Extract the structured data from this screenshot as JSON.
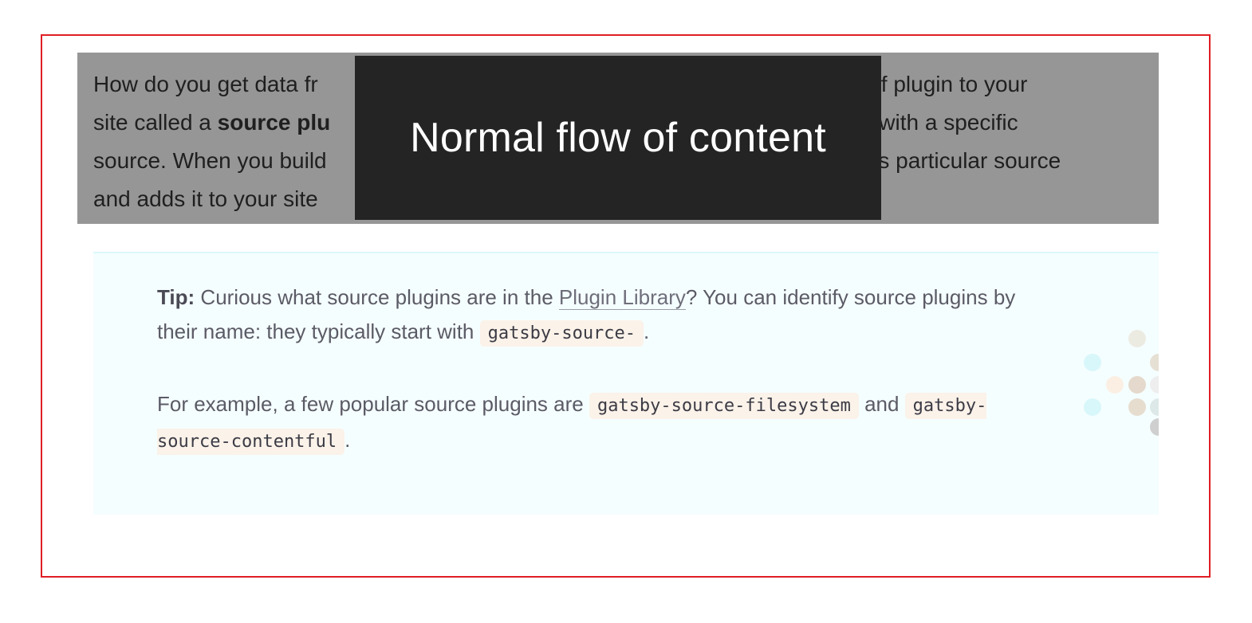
{
  "intro": {
    "text_start": "How do you get data fr",
    "text_mid_1": " type of plugin to your",
    "line2_start": "site called a ",
    "bold_term": "source plu",
    "line2_end": "unicate with a specific",
    "line3_start": "source. When you build",
    "line3_end": " its particular source",
    "line4_start": "and adds it to your site"
  },
  "overlay": {
    "label": "Normal flow of content"
  },
  "tip": {
    "prefix": "Tip:",
    "p1_text_a": " Curious what source plugins are in the ",
    "link_label": "Plugin Library",
    "p1_text_b": "? You can identify source plugins by their name: they typically start with ",
    "code1": "gatsby-source-",
    "p1_end": ".",
    "p2_text_a": "For example, a few popular source plugins are ",
    "code2": "gatsby-source-filesystem",
    "p2_text_b": " and ",
    "code3": "gatsby-source-contentful",
    "p2_end": "."
  },
  "colors": {
    "frame": "#e01e24",
    "grey_block": "#969696",
    "overlay": "#242424",
    "tip_bg": "#f5feff",
    "code_bg": "#fbf2e9"
  }
}
